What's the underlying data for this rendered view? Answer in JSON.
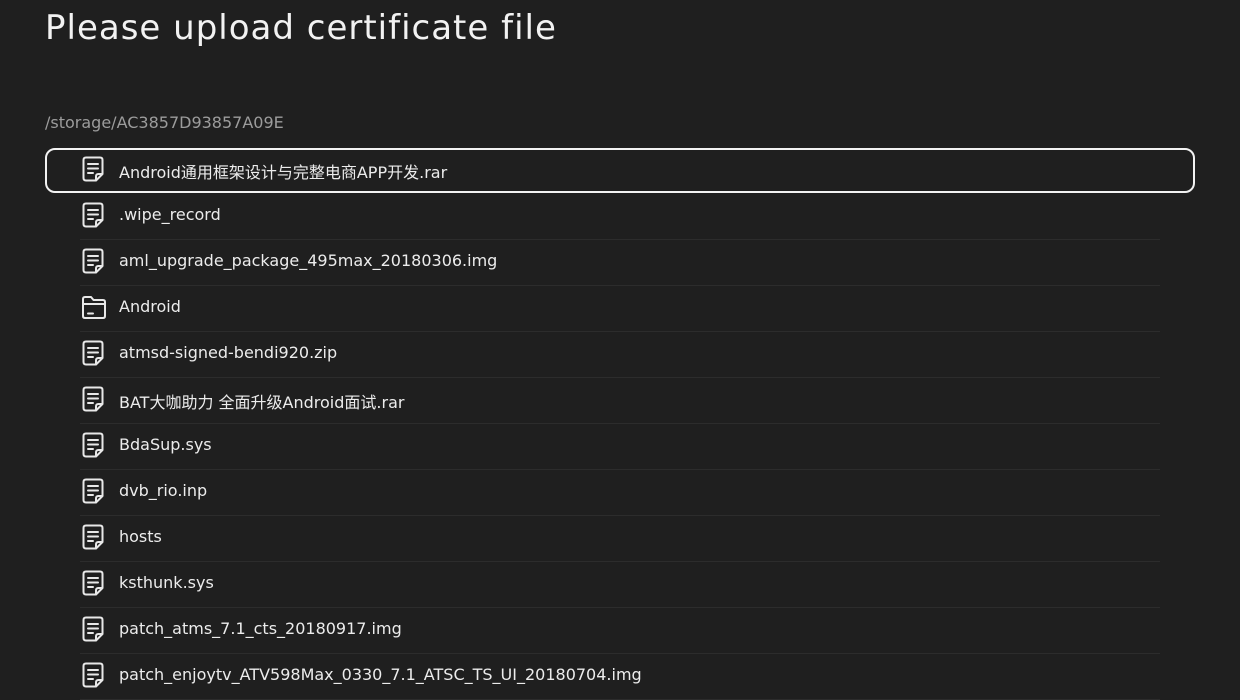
{
  "header": {
    "title": "Please upload certificate file"
  },
  "location": {
    "path": "/storage/AC3857D93857A09E"
  },
  "files": [
    {
      "name": "Android通用框架设计与完整电商APP开发.rar",
      "type": "file",
      "icon": "document-icon",
      "focused": true
    },
    {
      "name": ".wipe_record",
      "type": "file",
      "icon": "document-icon",
      "focused": false
    },
    {
      "name": "aml_upgrade_package_495max_20180306.img",
      "type": "file",
      "icon": "document-icon",
      "focused": false
    },
    {
      "name": "Android",
      "type": "folder",
      "icon": "folder-icon",
      "focused": false
    },
    {
      "name": "atmsd-signed-bendi920.zip",
      "type": "file",
      "icon": "document-icon",
      "focused": false
    },
    {
      "name": "BAT大咖助力 全面升级Android面试.rar",
      "type": "file",
      "icon": "document-icon",
      "focused": false
    },
    {
      "name": "BdaSup.sys",
      "type": "file",
      "icon": "document-icon",
      "focused": false
    },
    {
      "name": "dvb_rio.inp",
      "type": "file",
      "icon": "document-icon",
      "focused": false
    },
    {
      "name": "hosts",
      "type": "file",
      "icon": "document-icon",
      "focused": false
    },
    {
      "name": "ksthunk.sys",
      "type": "file",
      "icon": "document-icon",
      "focused": false
    },
    {
      "name": "patch_atms_7.1_cts_20180917.img",
      "type": "file",
      "icon": "document-icon",
      "focused": false
    },
    {
      "name": "patch_enjoytv_ATV598Max_0330_7.1_ATSC_TS_UI_20180704.img",
      "type": "file",
      "icon": "document-icon",
      "focused": false
    }
  ],
  "colors": {
    "background": "#1f1f1f",
    "text": "#ececec",
    "path_text": "#9c9c9c",
    "focus_border": "#f2f2f2",
    "divider": "#2c2c2c"
  }
}
